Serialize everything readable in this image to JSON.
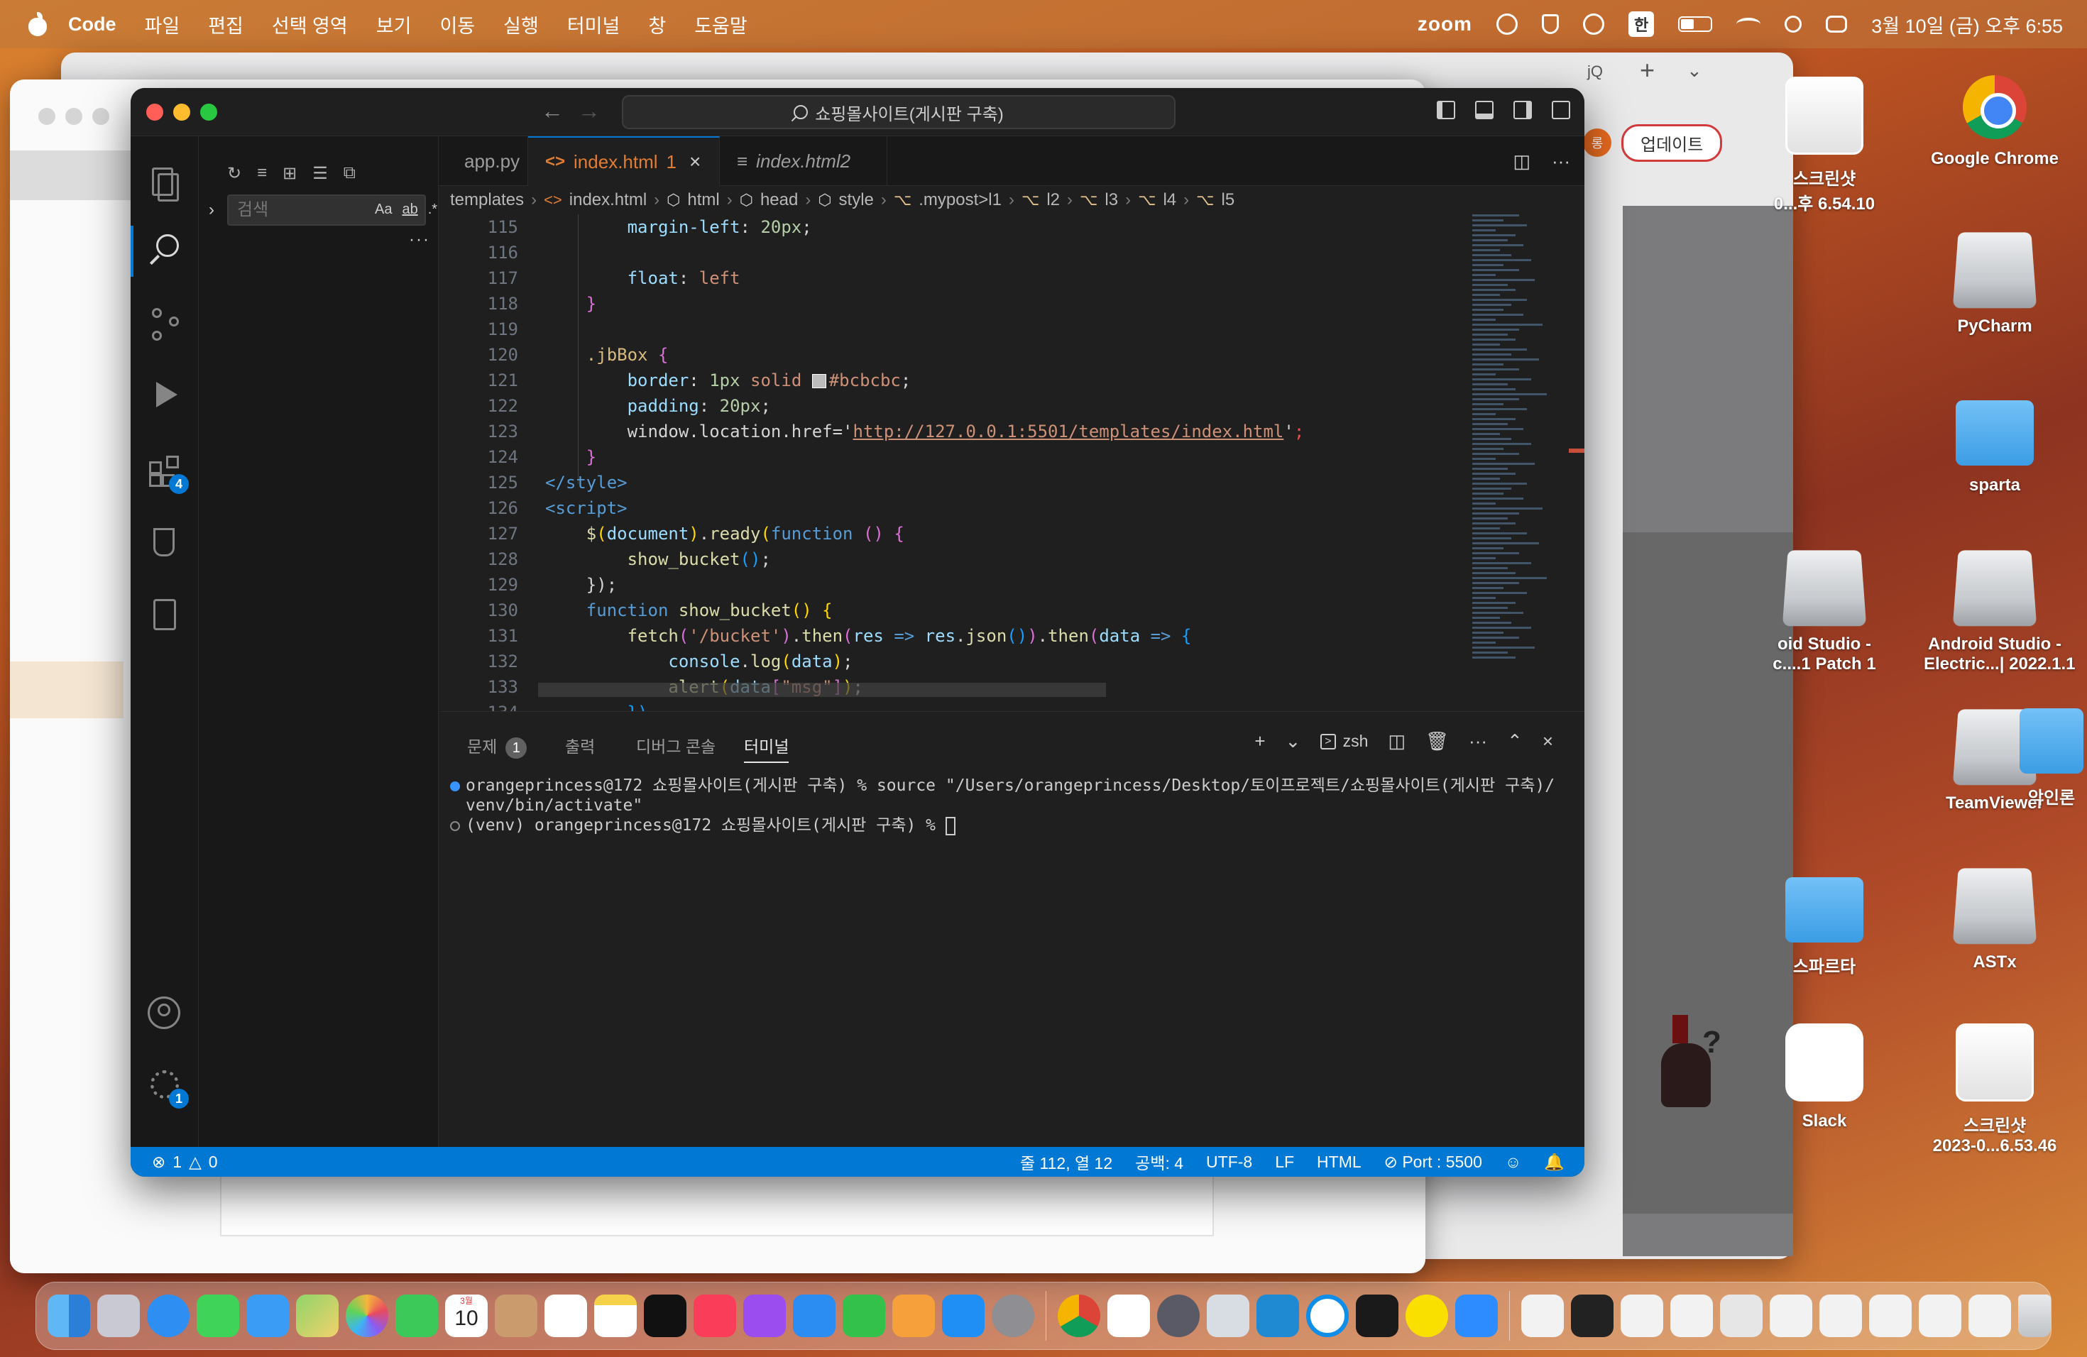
{
  "menubar": {
    "app_name": "Code",
    "items": [
      "파일",
      "편집",
      "선택 영역",
      "보기",
      "이동",
      "실행",
      "터미널",
      "창",
      "도움말"
    ],
    "zoom_label": "zoom",
    "input_method": "한",
    "clock": "3월 10일 (금) 오후 6:55"
  },
  "background_browser": {
    "avatar_initial": "롱",
    "update_label": "업데이트",
    "tab_fragment": "jQ"
  },
  "desktop": {
    "icons": [
      {
        "label": "스크린샷\n0...후 6.54.10",
        "kind": "screenshot"
      },
      {
        "label": "Google Chrome",
        "kind": "chrome"
      },
      {
        "label": "PyCharm",
        "kind": "drive"
      },
      {
        "label": "sparta",
        "kind": "folder"
      },
      {
        "label": "oid Studio -\nc....1 Patch 1",
        "kind": "drive"
      },
      {
        "label": "Android Studio -\nElectric...| 2022.1.1",
        "kind": "drive"
      },
      {
        "label": "TeamViewer",
        "kind": "drive"
      },
      {
        "label": "악인론",
        "kind": "folder"
      },
      {
        "label": "스파르타",
        "kind": "folder"
      },
      {
        "label": "ASTx",
        "kind": "drive"
      },
      {
        "label": "Slack",
        "kind": "slack"
      },
      {
        "label": "스크린샷\n2023-0...6.53.46",
        "kind": "screenshot"
      }
    ]
  },
  "vscode": {
    "command_center": "쇼핑몰사이트(게시판 구축)",
    "sidebar": {
      "search_placeholder": "검색",
      "opt_case": "Aa",
      "opt_word": "ab",
      "opt_regex": ".*"
    },
    "activity_badges": {
      "extensions": "4",
      "settings": "1"
    },
    "tabs": [
      {
        "label": "app.py",
        "icon": "python-icon",
        "active": false
      },
      {
        "label": "index.html",
        "modified_count": "1",
        "icon": "html-icon",
        "active": true
      },
      {
        "label": "index.html2",
        "icon": "text-file-icon",
        "active": false
      }
    ],
    "breadcrumbs": [
      "templates",
      "index.html",
      "html",
      "head",
      "style",
      ".mypost>l1",
      "l2",
      "l3",
      "l4",
      "l5"
    ],
    "editor": {
      "line_numbers": [
        "115",
        "116",
        "117",
        "118",
        "119",
        "120",
        "121",
        "122",
        "123",
        "124",
        "125",
        "126",
        "127",
        "128",
        "129",
        "130",
        "131",
        "132",
        "133",
        "134"
      ],
      "lines": {
        "l115": {
          "prop": "margin-left",
          "num": "20px"
        },
        "l117": {
          "prop": "float",
          "val": "left"
        },
        "l118": "}",
        "l120": {
          "sel": ".jbBox",
          "brace": "{"
        },
        "l121": {
          "prop": "border",
          "num": "1px",
          "val": "solid",
          "color": "#bcbcbc"
        },
        "l122": {
          "prop": "padding",
          "num": "20px"
        },
        "l123": {
          "obj": "window",
          "key": "location",
          "prop": "href",
          "url": "http://127.0.0.1:5501/templates/index.html"
        },
        "l124": "}",
        "l125": "</style>",
        "l126": "<script>",
        "l127": {
          "fn": "$",
          "arg": "document",
          "method": "ready",
          "kw": "function"
        },
        "l128": {
          "call": "show_bucket"
        },
        "l129": "});",
        "l130": {
          "kw": "function",
          "name": "show_bucket"
        },
        "l131": {
          "fn": "fetch",
          "path": "'/bucket'",
          "then1": "then",
          "param1": "res",
          "json_obj": "res",
          "json": "json",
          "then2": "then",
          "param2": "data"
        },
        "l132": {
          "obj": "console",
          "method": "log",
          "arg": "data"
        },
        "l133": {
          "fn": "alert",
          "arg": "data",
          "key": "\"msg\""
        },
        "l134": "})"
      }
    },
    "panel": {
      "tabs": [
        {
          "label": "문제",
          "badge": "1"
        },
        {
          "label": "출력"
        },
        {
          "label": "디버그 콘솔"
        },
        {
          "label": "터미널",
          "active": true
        }
      ],
      "shell": "zsh",
      "terminal_lines": [
        "orangeprincess@172 쇼핑몰사이트(게시판 구축) % source \"/Users/orangeprincess/Desktop/토이프로젝트/쇼핑몰사이트(게시판 구축)/venv/bin/activate\"",
        "(venv) orangeprincess@172 쇼핑몰사이트(게시판 구축) % "
      ]
    },
    "statusbar": {
      "errors": "1",
      "warnings": "0",
      "position": "줄 112, 열 12",
      "spaces": "공백: 4",
      "encoding": "UTF-8",
      "eol": "LF",
      "language": "HTML",
      "port": "Port : 5500"
    }
  },
  "dock": {
    "calendar_day": "10",
    "calendar_month": "3월",
    "apps": [
      "finder-icon",
      "launchpad-icon",
      "safari-icon",
      "messages-icon",
      "mail-icon",
      "maps-icon",
      "photos-icon",
      "facetime-icon",
      "calendar-icon",
      "contacts-icon",
      "reminders-icon",
      "notes-icon",
      "tv-icon",
      "music-icon",
      "podcasts-icon",
      "keynote-icon",
      "numbers-icon",
      "pages-icon",
      "appstore-icon",
      "settings-icon",
      "chrome-icon",
      "slack-icon",
      "rocket-icon",
      "preview-icon",
      "vscode-icon",
      "teamviewer-icon",
      "terminal-icon",
      "kakaotalk-icon",
      "zoom-icon"
    ]
  },
  "colors": {
    "statusbar": "#0078d4",
    "tab_active_text": "#e17d33",
    "editor_bg": "#1f1f1f",
    "dock_chrome": "#db4437"
  }
}
